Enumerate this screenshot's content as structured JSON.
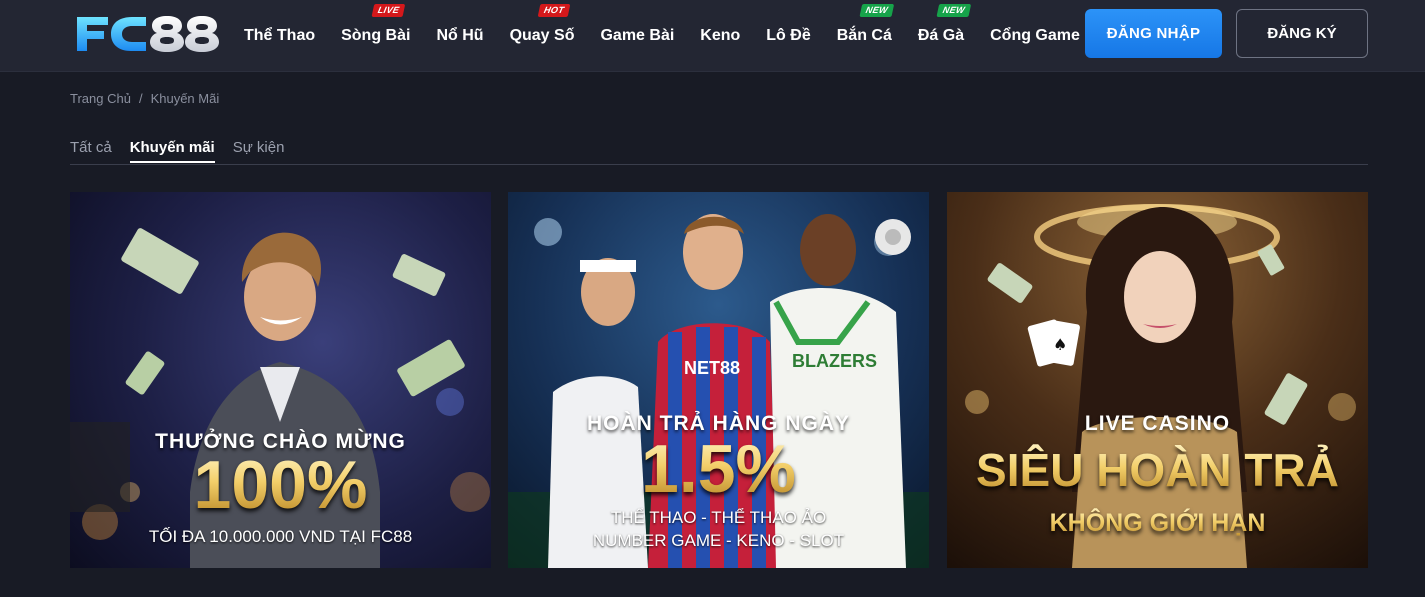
{
  "header": {
    "logo_text": "FC88",
    "nav": [
      {
        "label": "Thể Thao",
        "tag": ""
      },
      {
        "label": "Sòng Bài",
        "tag": "LIVE"
      },
      {
        "label": "Nổ Hũ",
        "tag": ""
      },
      {
        "label": "Quay Số",
        "tag": "HOT"
      },
      {
        "label": "Game Bài",
        "tag": ""
      },
      {
        "label": "Keno",
        "tag": ""
      },
      {
        "label": "Lô Đề",
        "tag": ""
      },
      {
        "label": "Bắn Cá",
        "tag": "NEW"
      },
      {
        "label": "Đá Gà",
        "tag": "NEW"
      },
      {
        "label": "Cổng Game",
        "tag": ""
      }
    ],
    "login_label": "ĐĂNG NHẬP",
    "register_label": "ĐĂNG KÝ"
  },
  "breadcrumb": {
    "home": "Trang Chủ",
    "separator": "/",
    "current": "Khuyến Mãi"
  },
  "tabs": [
    {
      "label": "Tất cả",
      "active": false
    },
    {
      "label": "Khuyến mãi",
      "active": true
    },
    {
      "label": "Sự kiện",
      "active": false
    }
  ],
  "promos": [
    {
      "headline": "THƯỞNG CHÀO MỪNG",
      "big": "100%",
      "sub1": "TỐI ĐA 10.000.000 VND TẠI FC88",
      "sub2": ""
    },
    {
      "headline": "HOÀN TRẢ HÀNG NGÀY",
      "big": "1.5%",
      "sub1": "THỂ THAO - THỂ THAO ẢO",
      "sub2": "NUMBER GAME - KENO - SLOT",
      "jersey_text": "NET88",
      "jersey2_text": "BLAZERS"
    },
    {
      "headline": "LIVE CASINO",
      "big": "SIÊU HOÀN TRẢ",
      "sub1": "KHÔNG GIỚI HẠN",
      "sub2": ""
    }
  ],
  "colors": {
    "background": "#181b25",
    "header": "#232633",
    "accent_blue": "#1f86f0",
    "tag_red": "#d4181b",
    "tag_green": "#16a34a",
    "gold": "#f3cf6a"
  }
}
